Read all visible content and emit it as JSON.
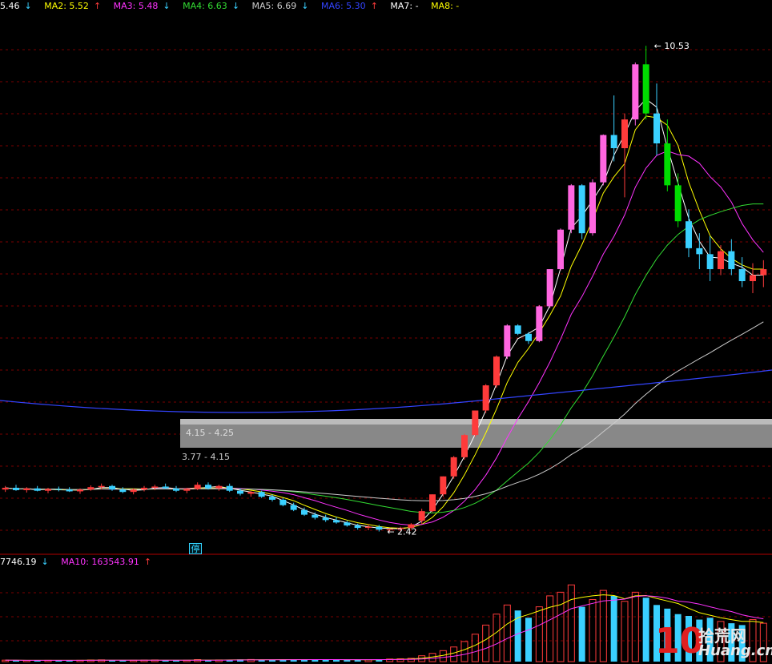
{
  "price_legend": {
    "ma1": {
      "label": "5.46",
      "arrow": "↓",
      "color": "#ffffff"
    },
    "ma2": {
      "label": "MA2: 5.52",
      "arrow": "↑",
      "color": "#ffff00"
    },
    "ma3": {
      "label": "MA3: 5.48",
      "arrow": "↓",
      "color": "#ff33ff"
    },
    "ma4": {
      "label": "MA4: 6.63",
      "arrow": "↓",
      "color": "#33dd33"
    },
    "ma5": {
      "label": "MA5: 6.69",
      "arrow": "↓",
      "color": "#cccccc"
    },
    "ma6": {
      "label": "MA6: 5.30",
      "arrow": "↑",
      "color": "#3344ff"
    },
    "ma7": {
      "label": "MA7: -",
      "arrow": "",
      "color": "#ffffff"
    },
    "ma8": {
      "label": "MA8: -",
      "arrow": "",
      "color": "#ffff00"
    }
  },
  "volume_legend": {
    "v1": {
      "label": "7746.19",
      "arrow": "↓",
      "color": "#ffffff"
    },
    "v2": {
      "label": "MA10: 163543.91",
      "arrow": "↑",
      "color": "#ff33ff"
    }
  },
  "stop_tag": "停",
  "watermark": {
    "num": "10",
    "cn": "拾荒网",
    "en": "Huang.cn"
  },
  "colors": {
    "up": "#ff3b3b",
    "up_fill": "#ff66e0",
    "down": "#3ad0ff",
    "big_down": "#00dd00",
    "grid": "#7a0000",
    "divider": "#b00000"
  },
  "chart_data": {
    "type": "candlestick",
    "price_ylim": [
      2.2,
      11.0
    ],
    "annotations": [
      {
        "text": "10.53",
        "candle": 60,
        "price": 10.53
      },
      {
        "text": "2.42",
        "candle": 35,
        "price": 2.42
      }
    ],
    "zones": [
      {
        "label": "4.15 - 4.25",
        "low": 4.15,
        "high": 4.25
      },
      {
        "label": "3.77 - 4.15",
        "low": 3.77,
        "high": 4.15
      }
    ],
    "ohlc": [
      [
        3.12,
        3.18,
        3.08,
        3.15
      ],
      [
        3.15,
        3.2,
        3.1,
        3.11
      ],
      [
        3.11,
        3.16,
        3.07,
        3.14
      ],
      [
        3.14,
        3.18,
        3.09,
        3.1
      ],
      [
        3.1,
        3.15,
        3.06,
        3.13
      ],
      [
        3.13,
        3.17,
        3.09,
        3.12
      ],
      [
        3.12,
        3.16,
        3.08,
        3.09
      ],
      [
        3.09,
        3.14,
        3.05,
        3.12
      ],
      [
        3.12,
        3.19,
        3.1,
        3.16
      ],
      [
        3.16,
        3.22,
        3.12,
        3.18
      ],
      [
        3.18,
        3.2,
        3.1,
        3.12
      ],
      [
        3.12,
        3.16,
        3.06,
        3.08
      ],
      [
        3.08,
        3.14,
        3.04,
        3.12
      ],
      [
        3.12,
        3.18,
        3.09,
        3.15
      ],
      [
        3.15,
        3.2,
        3.11,
        3.17
      ],
      [
        3.17,
        3.22,
        3.13,
        3.14
      ],
      [
        3.14,
        3.18,
        3.08,
        3.1
      ],
      [
        3.1,
        3.15,
        3.06,
        3.13
      ],
      [
        3.13,
        3.24,
        3.11,
        3.2
      ],
      [
        3.2,
        3.24,
        3.12,
        3.14
      ],
      [
        3.14,
        3.2,
        3.1,
        3.18
      ],
      [
        3.18,
        3.22,
        3.08,
        3.1
      ],
      [
        3.1,
        3.14,
        3.02,
        3.05
      ],
      [
        3.05,
        3.1,
        3.0,
        3.08
      ],
      [
        3.08,
        3.1,
        2.98,
        3.0
      ],
      [
        3.0,
        3.04,
        2.92,
        2.95
      ],
      [
        2.95,
        2.98,
        2.84,
        2.86
      ],
      [
        2.86,
        2.9,
        2.76,
        2.78
      ],
      [
        2.78,
        2.82,
        2.68,
        2.7
      ],
      [
        2.7,
        2.74,
        2.62,
        2.65
      ],
      [
        2.65,
        2.7,
        2.58,
        2.61
      ],
      [
        2.61,
        2.66,
        2.55,
        2.57
      ],
      [
        2.57,
        2.6,
        2.5,
        2.52
      ],
      [
        2.52,
        2.55,
        2.45,
        2.48
      ],
      [
        2.48,
        2.54,
        2.44,
        2.5
      ],
      [
        2.5,
        2.53,
        2.42,
        2.45
      ],
      [
        2.45,
        2.47,
        2.42,
        2.46
      ],
      [
        2.46,
        2.5,
        2.43,
        2.48
      ],
      [
        2.48,
        2.56,
        2.46,
        2.54
      ],
      [
        2.6,
        2.8,
        2.55,
        2.76
      ],
      [
        2.76,
        3.04,
        2.74,
        3.04
      ],
      [
        3.04,
        3.34,
        3.0,
        3.34
      ],
      [
        3.34,
        3.68,
        3.3,
        3.66
      ],
      [
        3.66,
        4.05,
        3.62,
        4.03
      ],
      [
        4.03,
        4.44,
        4.0,
        4.44
      ],
      [
        4.44,
        4.88,
        4.4,
        4.86
      ],
      [
        4.86,
        5.36,
        4.82,
        5.34
      ],
      [
        5.34,
        5.88,
        5.3,
        5.86
      ],
      [
        5.86,
        5.88,
        5.7,
        5.72
      ],
      [
        5.72,
        5.75,
        5.55,
        5.6
      ],
      [
        5.6,
        6.2,
        5.58,
        6.18
      ],
      [
        6.18,
        6.8,
        6.15,
        6.8
      ],
      [
        6.8,
        7.48,
        6.78,
        7.46
      ],
      [
        7.46,
        8.22,
        7.4,
        8.2
      ],
      [
        8.2,
        8.22,
        7.3,
        7.4
      ],
      [
        7.4,
        8.3,
        7.36,
        8.25
      ],
      [
        8.25,
        9.05,
        8.2,
        9.04
      ],
      [
        9.04,
        9.7,
        8.6,
        8.82
      ],
      [
        8.82,
        9.4,
        8.0,
        9.3
      ],
      [
        9.3,
        10.25,
        9.2,
        10.22
      ],
      [
        10.22,
        10.53,
        9.3,
        9.4
      ],
      [
        9.4,
        9.9,
        8.7,
        8.9
      ],
      [
        8.9,
        9.3,
        8.1,
        8.2
      ],
      [
        8.2,
        8.4,
        7.5,
        7.6
      ],
      [
        7.6,
        7.8,
        7.0,
        7.15
      ],
      [
        7.15,
        7.4,
        6.8,
        7.05
      ],
      [
        7.05,
        7.35,
        6.6,
        6.8
      ],
      [
        6.8,
        7.2,
        6.7,
        7.1
      ],
      [
        7.1,
        7.3,
        6.7,
        6.8
      ],
      [
        6.8,
        7.0,
        6.5,
        6.6
      ],
      [
        6.6,
        6.9,
        6.4,
        6.7
      ],
      [
        6.7,
        6.95,
        6.5,
        6.8
      ]
    ],
    "volume_ylim": [
      0,
      500000
    ],
    "volumes": [
      8000,
      7000,
      6500,
      7200,
      6800,
      7500,
      6200,
      7000,
      8800,
      9500,
      7800,
      6400,
      7100,
      8200,
      9000,
      7600,
      6900,
      7200,
      11000,
      8500,
      9000,
      9800,
      12000,
      11500,
      10500,
      9800,
      11000,
      12500,
      10800,
      11200,
      10000,
      9600,
      10200,
      11000,
      9500,
      12800,
      14000,
      15500,
      18000,
      32000,
      45000,
      60000,
      80000,
      110000,
      150000,
      200000,
      260000,
      310000,
      280000,
      240000,
      300000,
      360000,
      380000,
      420000,
      300000,
      340000,
      390000,
      360000,
      330000,
      380000,
      350000,
      310000,
      290000,
      260000,
      250000,
      230000,
      240000,
      220000,
      210000,
      200000,
      230000,
      210000
    ]
  }
}
